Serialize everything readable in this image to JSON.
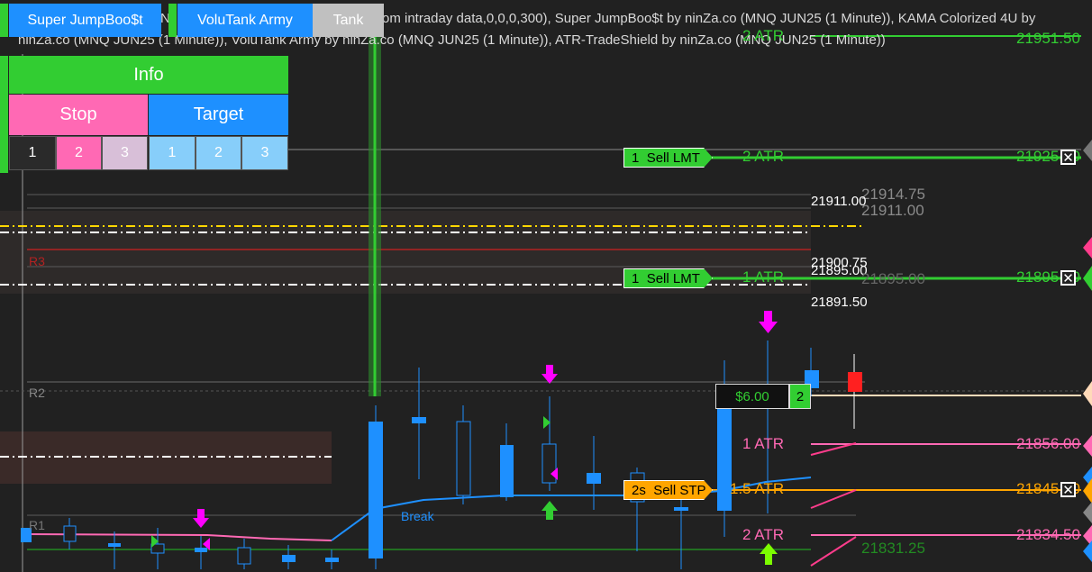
{
  "toolbar": {
    "super_label": "Super JumpBoo$t",
    "volutank_label": "VoluTank Army",
    "tank_label": "Tank"
  },
  "header": {
    "line1": "om intraday data,0,0,0,300), Super JumpBoo$t by ninZa.co (MNQ JUN25 (1 Minute)), KAMA Colorized 4U by",
    "line2": "ninZa.co (MNQ JUN25 (1 Minute)), VoluTank Army by ninZa.co (MNQ JUN25 (1 Minute)), ATR-TradeShield by ninZa.co (MNQ JUN25 (1 Minute))",
    "line1_prefix": "N"
  },
  "panel": {
    "info_label": "Info",
    "stop_label": "Stop",
    "target_label": "Target",
    "stop_qty": [
      "1",
      "2",
      "3"
    ],
    "target_qty": [
      "1",
      "2",
      "3"
    ]
  },
  "levels": {
    "r3": "R3",
    "r2": "R2",
    "r1": "R1",
    "break_label": "Break"
  },
  "orders": {
    "sell_lmt_1": {
      "qty": "1",
      "label": "Sell LMT",
      "atr": "2 ATR",
      "price": "21925.50"
    },
    "sell_lmt_2": {
      "qty": "1",
      "label": "Sell LMT",
      "atr": "1 ATR",
      "price": "21895.00"
    },
    "sell_stp": {
      "qty": "2s",
      "label": "Sell STP",
      "atr": "1.5 ATR",
      "price": "21845.50"
    },
    "position": {
      "pnl": "$6.00",
      "qty": "2"
    }
  },
  "atr_labels": {
    "top_atr": "2 ATR",
    "top_price": "21951.50",
    "atr1": "1 ATR",
    "atr1_price": "21856.00",
    "atr2": "2 ATR",
    "atr2_price": "21834.50"
  },
  "price_labels": {
    "p21914": "21914.75",
    "p21911a": "21911.00",
    "p21911b": "21911.00",
    "p21900": "21900.75",
    "p21895": "21895.00",
    "p21895b": "21895.00",
    "p21891": "21891.50",
    "p21831": "21831.25"
  },
  "colors": {
    "background": "#212121",
    "green": "#32cd32",
    "blue": "#1e90ff",
    "pink": "#ff69b4",
    "orange": "#ffa500",
    "magenta": "#ff00ff"
  }
}
